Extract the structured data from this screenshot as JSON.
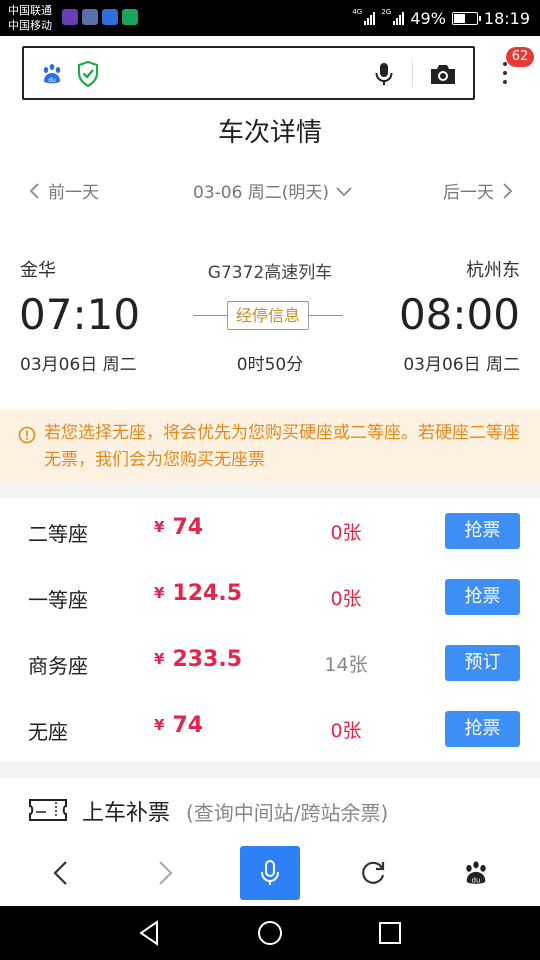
{
  "status_bar": {
    "carrier1": "中国联通",
    "carrier2": "中国移动",
    "net1": "4G",
    "net2": "2G",
    "battery_percent": "49%",
    "battery_level": 0.49,
    "time": "18:19"
  },
  "browser": {
    "notification_count": "62",
    "icons": [
      "baidu-du-icon",
      "security-shield-icon",
      "microphone-icon",
      "camera-icon",
      "more-menu-icon"
    ]
  },
  "page": {
    "title": "车次详情"
  },
  "date_nav": {
    "prev": "前一天",
    "current": "03-06 周二(明天)",
    "next": "后一天"
  },
  "train": {
    "from_station": "金华",
    "to_station": "杭州东",
    "train_number": "G7372高速列车",
    "depart_time": "07:10",
    "arrive_time": "08:00",
    "stops_label": "经停信息",
    "depart_date": "03月06日 周二",
    "arrive_date": "03月06日  周二",
    "duration": "0时50分"
  },
  "notice": {
    "text": "若您选择无座，将会优先为您购买硬座或二等座。若硬座二等座无票，我们会为您购买无座票"
  },
  "seats": [
    {
      "name": "二等座",
      "currency": "¥",
      "price": "74",
      "count": "0张",
      "action": "抢票",
      "count_color": "#e0284f"
    },
    {
      "name": "一等座",
      "currency": "¥",
      "price": "124.5",
      "count": "0张",
      "action": "抢票",
      "count_color": "#e0284f"
    },
    {
      "name": "商务座",
      "currency": "¥",
      "price": "233.5",
      "count": "14张",
      "action": "预订",
      "count_color": "#888888"
    },
    {
      "name": "无座",
      "currency": "¥",
      "price": "74",
      "count": "0张",
      "action": "抢票",
      "count_color": "#e0284f"
    }
  ],
  "extra": {
    "label": "上车补票",
    "sub": "(查询中间站/跨站余票)"
  },
  "colors": {
    "accent_blue": "#3d8ef5",
    "price_red": "#e0284f",
    "notice_orange": "#e08a1e",
    "notice_bg": "#fdf2e1"
  }
}
